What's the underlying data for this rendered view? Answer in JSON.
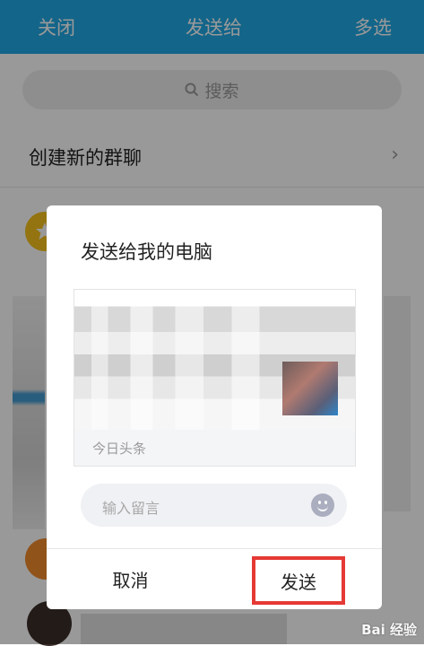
{
  "topbar": {
    "close_label": "关闭",
    "title": "发送给",
    "multi_label": "多选"
  },
  "search": {
    "placeholder": "搜索",
    "icon": "search-icon"
  },
  "list": {
    "create_group_label": "创建新的群聊",
    "create_group_icon": "chevron-right-icon"
  },
  "dialog": {
    "title": "发送给我的电脑",
    "card_source": "今日头条",
    "message_placeholder": "输入留言",
    "emoji_icon": "smiley-icon",
    "cancel_label": "取消",
    "send_label": "发送"
  },
  "watermark": "Bai 经验",
  "colors": {
    "header": "#20a8e4",
    "highlight_border": "#e53935"
  }
}
